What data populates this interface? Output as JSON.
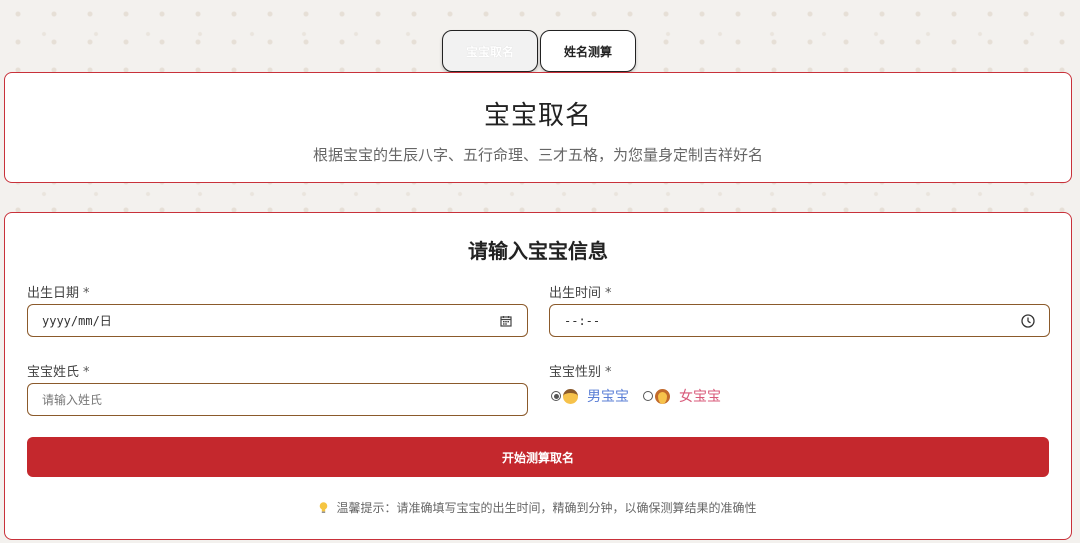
{
  "tabs": [
    {
      "label": "宝宝取名",
      "active": true
    },
    {
      "label": "姓名测算",
      "active": false
    }
  ],
  "header": {
    "title": "宝宝取名",
    "subtitle": "根据宝宝的生辰八字、五行命理、三才五格，为您量身定制吉祥好名"
  },
  "form": {
    "title": "请输入宝宝信息",
    "birth_date": {
      "label": "出生日期",
      "required_mark": "*",
      "value": "yyyy/mm/日",
      "icon": "calendar-icon"
    },
    "birth_time": {
      "label": "出生时间",
      "required_mark": "*",
      "value": "--:--",
      "icon": "clock-icon"
    },
    "surname": {
      "label": "宝宝姓氏",
      "required_mark": "*",
      "placeholder": "请输入姓氏"
    },
    "gender": {
      "label": "宝宝性别",
      "required_mark": "*",
      "options": [
        {
          "label": "男宝宝",
          "icon": "boy-face-icon",
          "selected": true
        },
        {
          "label": "女宝宝",
          "icon": "girl-face-icon",
          "selected": false
        }
      ]
    },
    "submit_label": "开始测算取名",
    "tip": "温馨提示：请准确填写宝宝的出生时间，精确到分钟，以确保测算结果的准确性"
  },
  "colors": {
    "accent": "#c4282d",
    "card_border": "#c8313a",
    "input_border": "#8b5a2b",
    "male_text": "#5b7fd6",
    "female_text": "#d85a7a"
  }
}
